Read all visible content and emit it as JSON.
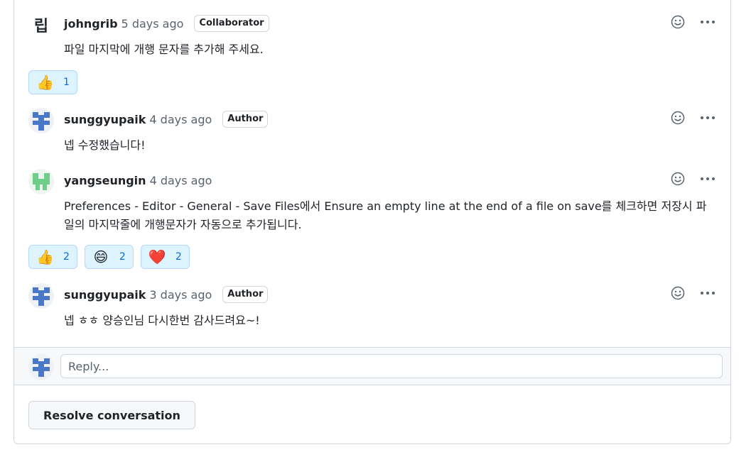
{
  "comments": [
    {
      "avatar_text": "립",
      "author": "johngrib",
      "time": "5 days ago",
      "badge": "Collaborator",
      "body": "파일 마지막에 개행 문자를 추가해 주세요.",
      "reactions": [
        {
          "icon": "thumbs-up",
          "emoji": "👍",
          "count": "1"
        }
      ]
    },
    {
      "avatar_color": "#4a78c8",
      "author": "sunggyupaik",
      "time": "4 days ago",
      "badge": "Author",
      "body": "넵 수정했습니다!"
    },
    {
      "avatar_color": "#6fcf8a",
      "author": "yangseungin",
      "time": "4 days ago",
      "body_line1": "Preferences - Editor - General - Save Files에서 Ensure an empty line at the end of a file on save를 체크하면 저장시 파",
      "body_line2": "일의 마지막줄에 개행문자가 자동으로 추가됩니다.",
      "reactions": [
        {
          "icon": "thumbs-up",
          "emoji": "👍",
          "count": "2"
        },
        {
          "icon": "laugh",
          "emoji": "😄",
          "count": "2"
        },
        {
          "icon": "heart",
          "emoji": "❤️",
          "count": "2"
        }
      ]
    },
    {
      "avatar_color": "#4a78c8",
      "author": "sunggyupaik",
      "time": "3 days ago",
      "badge": "Author",
      "body": "넵 ㅎㅎ 양승인님 다시한번 감사드려요~!"
    }
  ],
  "reply": {
    "placeholder": "Reply...",
    "avatar_color": "#4a78c8"
  },
  "resolve_label": "Resolve conversation",
  "colors": {
    "reaction_bg": "#ddf4ff",
    "reaction_border": "#b6d7ff",
    "count_blue": "#0969da"
  }
}
